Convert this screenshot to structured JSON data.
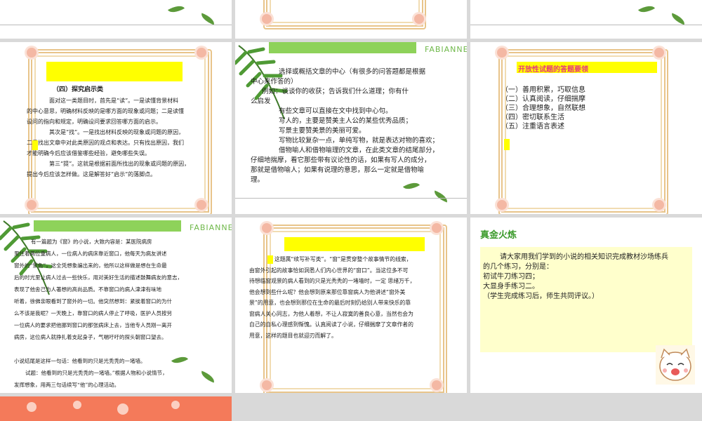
{
  "slides": {
    "s4": {
      "heading": "（四）探究启示类",
      "lines": [
        "面对这一类题目时，首先是“读”。一是读懂背景材料",
        "的中心意思，明确材料反映的是哪方面的现象或问题；二是读懂",
        "设问的指向和规定，明确设问要求回答哪方面的启示。",
        "其次是“找”。一是找出材料反映的现象或问题的原因，",
        "二是找出文章中对此类原因的观点和表达。只有找出原因，我们",
        "才能明确今后应该借鉴哪些经验，避免哪些失误。",
        "第三“提”。这就是根据前面所找出的现象或问题的原因，",
        "提出今后应该怎样做。这是解答好“启示”的落脚点。"
      ]
    },
    "s5": {
      "brand": "FABIANNE",
      "lines": [
        "选择或概括文章的中心（有很多的问答题都是根据",
        "中心来作答的）",
        "例如：谈谈你的收获；告诉我们什么道理；你有什",
        "么启发",
        "有些文章可以直接在文中找到中心句。",
        "写人的，主要是赞美主人公的某些优秀品质；",
        "写景主要赞美景的美丽可爱。",
        "写物比较复杂一点，单纯写物，就是表达对物的喜欢；",
        "借物喻人和借物喻理的文章，在此类文章的结尾部分，",
        "仔细地揣摩，看它那些带有议论性的话，如果有写人的成分，",
        "那就是借物喻人；如果有说理的意思，那么一定就是借物喻",
        "理。"
      ]
    },
    "s6": {
      "title": "开放性试题的答题要领",
      "items": [
        "（一）善用积累，巧取信息",
        "（二）认真阅读，仔细揣摩",
        "（三）合理想象，自然联想",
        "（四）密切联系生活",
        "（五）注重语言表述"
      ]
    },
    "s7": {
      "brand": "FABIANNE",
      "lines": [
        "有一篇题为《窗》的小说，大致内容是：某医院病房",
        "里住着两位重病人，一位病人的病床靠近窗口，他每天为病友讲述",
        "窗外的“景色”，这全凭想象编出来的，他所以这样做是想在生命最",
        "后的时光里让病人过去一些快乐，用对美好生活的描述鼓舞病友的意志，",
        "表现了他舍己为人著想的高尚品质。不靠窗口的病人津津有味地",
        "听着，徐佛亲眼看到了窗外的一切。他突然想到：紧挨着窗口的为什",
        "么不该是我呢？一天晚上，靠窗口的病人停止了呼吸，医护人员按另",
        "一位病人的要求把他挪到窗口的那张病床上去，当他专人员刚一离开",
        "病房，这位病人就挣扎着支起身子，气喘吁吁的探头朝窗口望去。",
        "",
        "小说结尾是这样一句话：他看到的只是光秃秃的一堵墙。",
        "试题：他看到的只是光秃秃的一堵墙。”根据人物和小说情节，",
        "发挥想象，用两三句话续写“他”的心理活动。"
      ]
    },
    "s8": {
      "lines": [
        "这题属“续写补写类”。“窗”是贯穿整个故事情节的线索，",
        "由窗外引起的故事恰如洞悉人们内心世界的“窗口”。当这位多不可",
        "待想临窗观景的病人看到的只是光秃秃的一堵墙时，一定 思绪万千，",
        "他会想到些什么呢？他会想到原来那位靠窗病人为他讲述“窗外美",
        "景”的用意，也会想到那位在生命的最后时刻仍给别人带来快乐的靠",
        "窗病人关心同志，为他人着想，不让人寂寞的善良心意，当然也会为",
        "自己的自私心理感到惭愧。认真阅读了小说，仔细揣摩了文章作者的",
        "用意，这样的题目也就迎刃而解了。"
      ]
    },
    "s9": {
      "title": "真金火炼",
      "lines": [
        "请大家用我们学到的小说的相关知识完成教材沙场练兵",
        "的几个练习，分别是：",
        "初试牛刀练习四；",
        "大显身手练习二。",
        "（学生完成练习后，师生共同评议。）"
      ]
    }
  },
  "colors": {
    "highlight": "#ffff00",
    "accent_green": "#8ed25a",
    "title_green": "#3a9a2a",
    "frame": "#e8c48a",
    "orange_bottom": "#f47a5a"
  }
}
